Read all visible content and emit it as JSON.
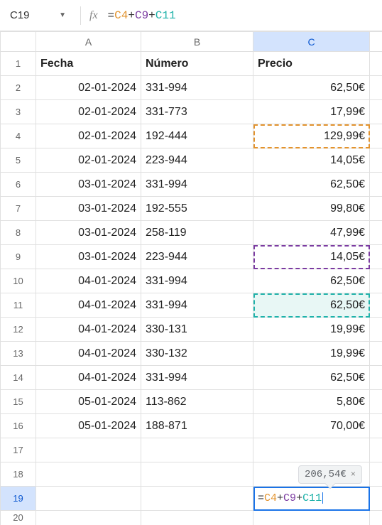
{
  "namebox": {
    "ref": "C19"
  },
  "formula_bar": {
    "eq": "=",
    "ref1": "C4",
    "plus": "+",
    "ref2": "C9",
    "ref3": "C11"
  },
  "cols": {
    "A": "A",
    "B": "B",
    "C": "C"
  },
  "headers": {
    "fecha": "Fecha",
    "numero": "Número",
    "precio": "Precio"
  },
  "rows": [
    {
      "n": "1"
    },
    {
      "n": "2",
      "fecha": "02-01-2024",
      "numero": "331-994",
      "precio": "62,50€"
    },
    {
      "n": "3",
      "fecha": "02-01-2024",
      "numero": "331-773",
      "precio": "17,99€"
    },
    {
      "n": "4",
      "fecha": "02-01-2024",
      "numero": "192-444",
      "precio": "129,99€"
    },
    {
      "n": "5",
      "fecha": "02-01-2024",
      "numero": "223-944",
      "precio": "14,05€"
    },
    {
      "n": "6",
      "fecha": "03-01-2024",
      "numero": "331-994",
      "precio": "62,50€"
    },
    {
      "n": "7",
      "fecha": "03-01-2024",
      "numero": "192-555",
      "precio": "99,80€"
    },
    {
      "n": "8",
      "fecha": "03-01-2024",
      "numero": "258-119",
      "precio": "47,99€"
    },
    {
      "n": "9",
      "fecha": "03-01-2024",
      "numero": "223-944",
      "precio": "14,05€"
    },
    {
      "n": "10",
      "fecha": "04-01-2024",
      "numero": "331-994",
      "precio": "62,50€"
    },
    {
      "n": "11",
      "fecha": "04-01-2024",
      "numero": "331-994",
      "precio": "62,50€"
    },
    {
      "n": "12",
      "fecha": "04-01-2024",
      "numero": "330-131",
      "precio": "19,99€"
    },
    {
      "n": "13",
      "fecha": "04-01-2024",
      "numero": "330-132",
      "precio": "19,99€"
    },
    {
      "n": "14",
      "fecha": "04-01-2024",
      "numero": "331-994",
      "precio": "62,50€"
    },
    {
      "n": "15",
      "fecha": "05-01-2024",
      "numero": "113-862",
      "precio": "5,80€"
    },
    {
      "n": "16",
      "fecha": "05-01-2024",
      "numero": "188-871",
      "precio": "70,00€"
    },
    {
      "n": "17"
    },
    {
      "n": "18"
    },
    {
      "n": "19"
    },
    {
      "n": "20"
    }
  ],
  "result_tooltip": {
    "value": "206,54€",
    "close": "×"
  },
  "active_formula": {
    "eq": "=",
    "ref1": "C4",
    "plus": "+",
    "ref2": "C9",
    "ref3": "C11"
  },
  "chart_data": {
    "type": "table",
    "columns": [
      "Fecha",
      "Número",
      "Precio"
    ],
    "data": [
      [
        "02-01-2024",
        "331-994",
        62.5
      ],
      [
        "02-01-2024",
        "331-773",
        17.99
      ],
      [
        "02-01-2024",
        "192-444",
        129.99
      ],
      [
        "02-01-2024",
        "223-944",
        14.05
      ],
      [
        "03-01-2024",
        "331-994",
        62.5
      ],
      [
        "03-01-2024",
        "192-555",
        99.8
      ],
      [
        "03-01-2024",
        "258-119",
        47.99
      ],
      [
        "03-01-2024",
        "223-944",
        14.05
      ],
      [
        "04-01-2024",
        "331-994",
        62.5
      ],
      [
        "04-01-2024",
        "331-994",
        62.5
      ],
      [
        "04-01-2024",
        "330-131",
        19.99
      ],
      [
        "04-01-2024",
        "330-132",
        19.99
      ],
      [
        "04-01-2024",
        "331-994",
        62.5
      ],
      [
        "05-01-2024",
        "113-862",
        5.8
      ],
      [
        "05-01-2024",
        "188-871",
        70.0
      ]
    ],
    "formula_cell": "C19",
    "formula": "=C4+C9+C11",
    "formula_result": 206.54,
    "currency": "€"
  }
}
